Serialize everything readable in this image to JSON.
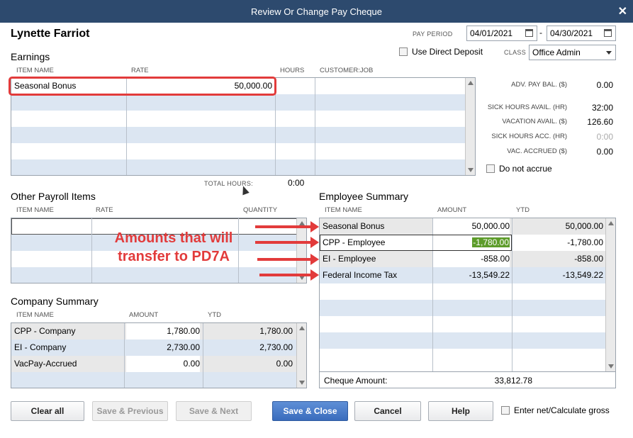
{
  "window": {
    "title": "Review Or Change Pay Cheque",
    "close_label": "✕"
  },
  "employee_name": "Lynette Farriot",
  "pay_period": {
    "label": "PAY PERIOD",
    "start": "04/01/2021",
    "separator": "-",
    "end": "04/30/2021"
  },
  "direct_deposit": {
    "label": "Use Direct Deposit",
    "checked": false
  },
  "class": {
    "label": "CLASS",
    "value": "Office Admin"
  },
  "earnings": {
    "title": "Earnings",
    "columns": [
      "ITEM NAME",
      "RATE",
      "HOURS",
      "CUSTOMER:JOB"
    ],
    "rows": [
      {
        "item": "Seasonal Bonus",
        "rate": "50,000.00",
        "hours": "",
        "customer": ""
      }
    ],
    "total_hours_label": "TOTAL HOURS:",
    "total_hours_value": "0:00"
  },
  "balances": {
    "adv_pay_bal": {
      "label": "ADV. PAY BAL. ($)",
      "value": "0.00"
    },
    "sick_hours_avail": {
      "label": "SICK HOURS AVAIL. (HR)",
      "value": "32:00"
    },
    "vacation_avail": {
      "label": "VACATION AVAIL. ($)",
      "value": "126.60"
    },
    "sick_hours_acc": {
      "label": "SICK HOURS ACC. (HR)",
      "value": "0:00"
    },
    "vac_accrued": {
      "label": "VAC. ACCRUED ($)",
      "value": "0.00"
    },
    "do_not_accrue": {
      "label": "Do not accrue",
      "checked": false
    }
  },
  "other_payroll": {
    "title": "Other Payroll Items",
    "columns": [
      "ITEM NAME",
      "RATE",
      "QUANTITY"
    ]
  },
  "employee_summary": {
    "title": "Employee Summary",
    "columns": [
      "ITEM NAME",
      "AMOUNT",
      "YTD"
    ],
    "rows": [
      {
        "item": "Seasonal Bonus",
        "amount": "50,000.00",
        "ytd": "50,000.00"
      },
      {
        "item": "CPP - Employee",
        "amount": "-1,780.00",
        "ytd": "-1,780.00"
      },
      {
        "item": "EI - Employee",
        "amount": "-858.00",
        "ytd": "-858.00"
      },
      {
        "item": "Federal Income Tax",
        "amount": "-13,549.22",
        "ytd": "-13,549.22"
      }
    ],
    "cheque_amount_label": "Cheque Amount:",
    "cheque_amount_value": "33,812.78"
  },
  "company_summary": {
    "title": "Company Summary",
    "columns": [
      "ITEM NAME",
      "AMOUNT",
      "YTD"
    ],
    "rows": [
      {
        "item": "CPP - Company",
        "amount": "1,780.00",
        "ytd": "1,780.00"
      },
      {
        "item": "EI - Company",
        "amount": "2,730.00",
        "ytd": "2,730.00"
      },
      {
        "item": "VacPay-Accrued",
        "amount": "0.00",
        "ytd": "0.00"
      }
    ]
  },
  "annotation": {
    "line1": "Amounts that will",
    "line2": "transfer to PD7A",
    "color": "#e23b3b"
  },
  "buttons": {
    "clear_all": "Clear all",
    "save_previous": "Save & Previous",
    "save_next": "Save & Next",
    "save_close": "Save & Close",
    "cancel": "Cancel",
    "help": "Help"
  },
  "enter_net": {
    "label": "Enter net/Calculate gross",
    "checked": false
  }
}
